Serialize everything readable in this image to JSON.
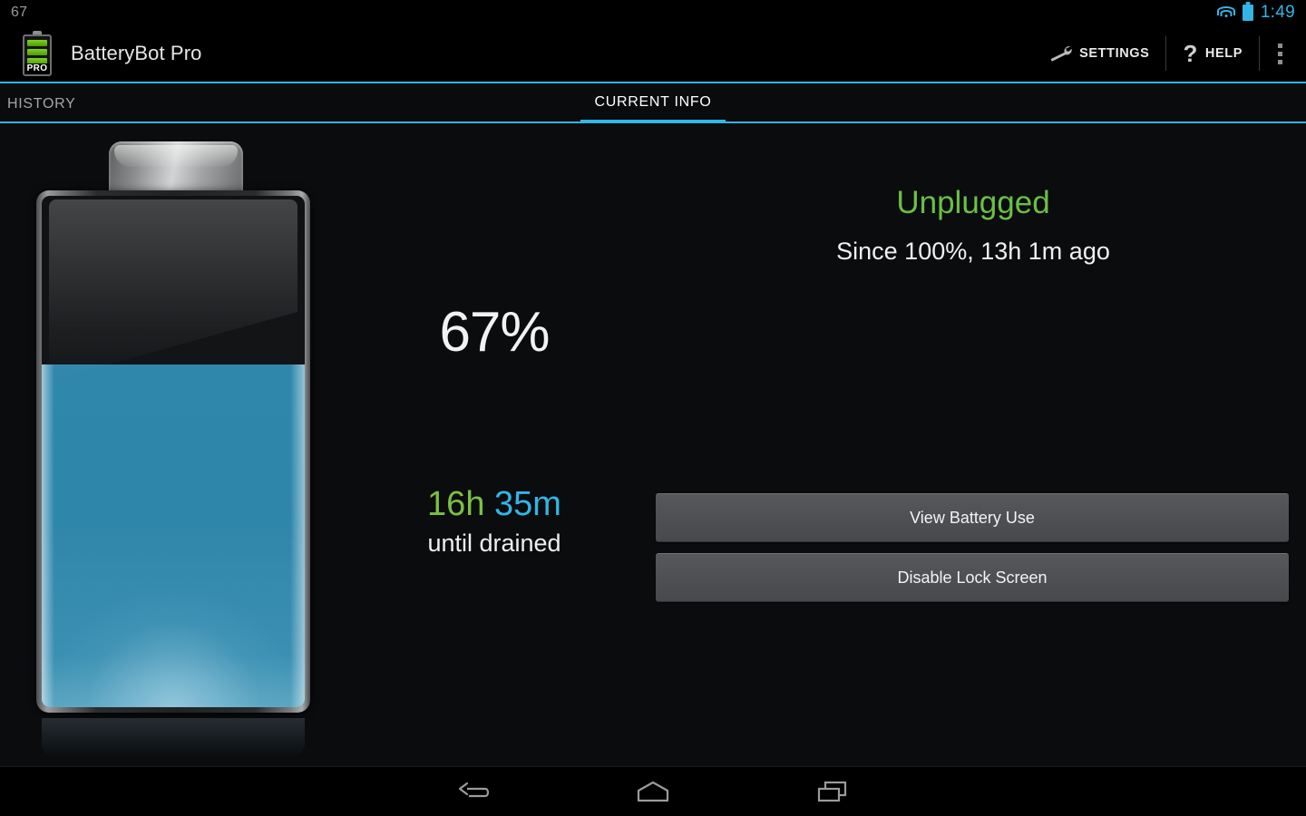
{
  "status_bar": {
    "left_text": "67",
    "clock": "1:49",
    "wifi_icon": "wifi-icon",
    "battery_icon": "battery-icon",
    "accent_color": "#33b5e5"
  },
  "action_bar": {
    "app_icon": "battery-pro-icon",
    "app_icon_badge": "PRO",
    "title": "BatteryBot Pro",
    "settings": {
      "icon": "wrench-icon",
      "label": "SETTINGS"
    },
    "help": {
      "icon": "question-mark-icon",
      "label": "HELP"
    },
    "overflow": "overflow-menu-icon"
  },
  "tabs": [
    {
      "label": "HISTORY",
      "active": false
    },
    {
      "label": "CURRENT INFO",
      "active": true
    }
  ],
  "main": {
    "battery_graphic": {
      "name": "battery-level-graphic",
      "fill_percent": 67,
      "fill_color": "#2f87ab"
    },
    "percent": "67%",
    "estimate": {
      "hours": "16h",
      "minutes": "35m",
      "caption": "until drained",
      "hours_color": "#7bc043",
      "minutes_color": "#33b5e5"
    },
    "plug_status": {
      "state": "Unplugged",
      "state_color": "#6ac045",
      "since": "Since 100%, 13h 1m ago"
    },
    "buttons": [
      {
        "label": "View Battery Use"
      },
      {
        "label": "Disable Lock Screen"
      }
    ]
  },
  "nav_bar": {
    "back": "back-icon",
    "home": "home-icon",
    "recents": "recents-icon"
  }
}
